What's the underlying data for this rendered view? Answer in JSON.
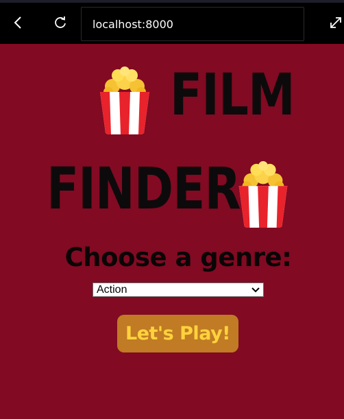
{
  "browser": {
    "url": "localhost:8000",
    "back_icon": "back-arrow-icon",
    "reload_icon": "reload-icon",
    "expand_icon": "expand-icon"
  },
  "header": {
    "line1": "FILM",
    "line2": "FINDER",
    "emoji_icon": "popcorn-icon"
  },
  "prompt": "Choose a genre:",
  "genre_select": {
    "selected": "Action"
  },
  "play_button": {
    "label": "Let's Play!"
  },
  "colors": {
    "background": "#820a22",
    "button": "#c07b24",
    "button_text": "#ffd23d",
    "title_text": "#0d0a0c"
  }
}
